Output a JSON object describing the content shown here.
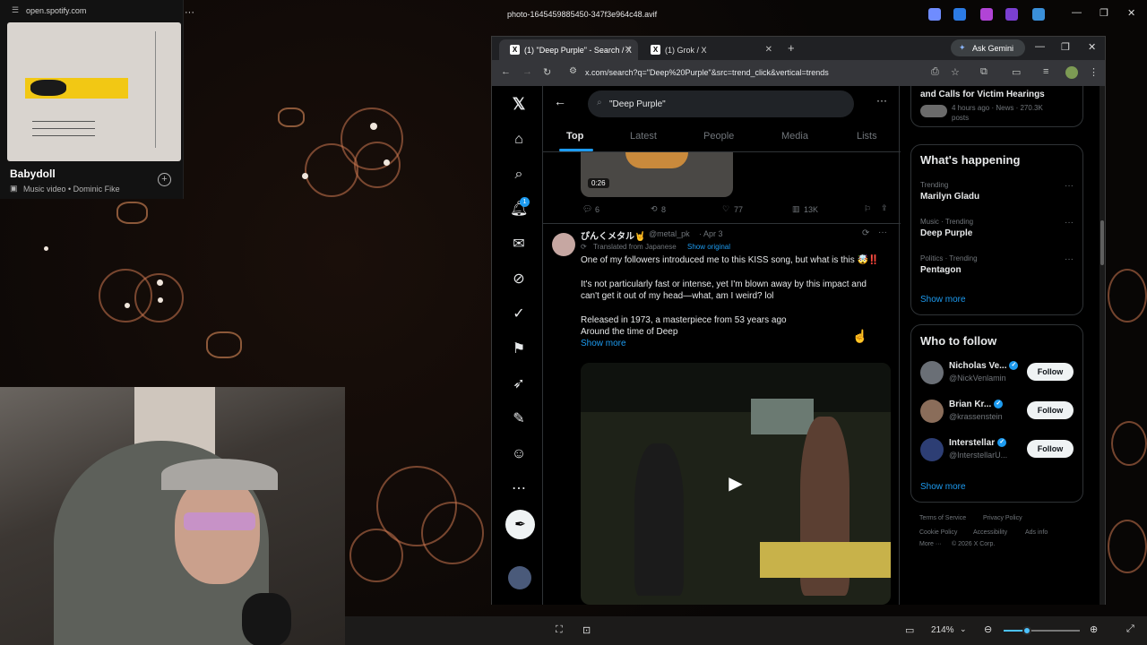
{
  "viewer": {
    "title": "photo-1645459885450-347f3e964c48.avif",
    "zoom": "214%"
  },
  "spotify": {
    "url": "open.spotify.com",
    "title": "Babydoll",
    "subtitle": "Music video • Dominic Fike"
  },
  "browser": {
    "tabs": [
      {
        "label": "(1) \"Deep Purple\" - Search / X"
      },
      {
        "label": "(1) Grok / X"
      }
    ],
    "url": "x.com/search?q=\"Deep%20Purple\"&src=trend_click&vertical=trends",
    "gemini_label": "Ask Gemini"
  },
  "search": {
    "query": "\"Deep Purple\""
  },
  "tabs": [
    "Top",
    "Latest",
    "People",
    "Media",
    "Lists"
  ],
  "prev_post": {
    "video_time": "0:26",
    "replies": "6",
    "reposts": "8",
    "likes": "77",
    "views": "13K"
  },
  "post": {
    "author": "ぴんくメタル🤘",
    "handle": "@metal_pk",
    "date": "· Apr 3",
    "translated": "Translated from Japanese",
    "show_original": "Show original",
    "line1": "One of my followers introduced me to this KISS song, but what is this 🤯‼️",
    "line2": "It's not particularly fast or intense, yet I'm blown away by this impact and",
    "line3": "can't get it out of my head—what, am I weird? lol",
    "line4": "Released in 1973, a masterpiece from 53 years ago",
    "line5": "Around the time of Deep",
    "show_more": "Show more"
  },
  "sidebar": {
    "top_story": {
      "title": "and Calls for Victim Hearings",
      "meta": "4 hours ago · News · 270.3K",
      "meta2": "posts"
    },
    "happening": {
      "heading": "What's happening",
      "items": [
        {
          "meta": "Trending",
          "name": "Marilyn Gladu"
        },
        {
          "meta": "Music · Trending",
          "name": "Deep Purple"
        },
        {
          "meta": "Politics · Trending",
          "name": "Pentagon"
        }
      ],
      "show_more": "Show more"
    },
    "follow": {
      "heading": "Who to follow",
      "items": [
        {
          "name": "Nicholas Ve...",
          "handle": "@NickVenlamin",
          "button": "Follow"
        },
        {
          "name": "Brian Kr...",
          "handle": "@krassenstein",
          "button": "Follow"
        },
        {
          "name": "Interstellar",
          "handle": "@InterstellarU...",
          "button": "Follow"
        }
      ],
      "show_more": "Show more"
    },
    "footer": {
      "terms": "Terms of Service",
      "privacy": "Privacy Policy",
      "cookie": "Cookie Policy",
      "accessibility": "Accessibility",
      "ads": "Ads info",
      "more": "More ···",
      "copyright": "© 2026 X Corp."
    }
  },
  "notifications_badge": "1",
  "colors": {
    "accent": "#1d9bf0",
    "bg": "#000000",
    "text": "#e7e9ea",
    "muted": "#71767b"
  }
}
